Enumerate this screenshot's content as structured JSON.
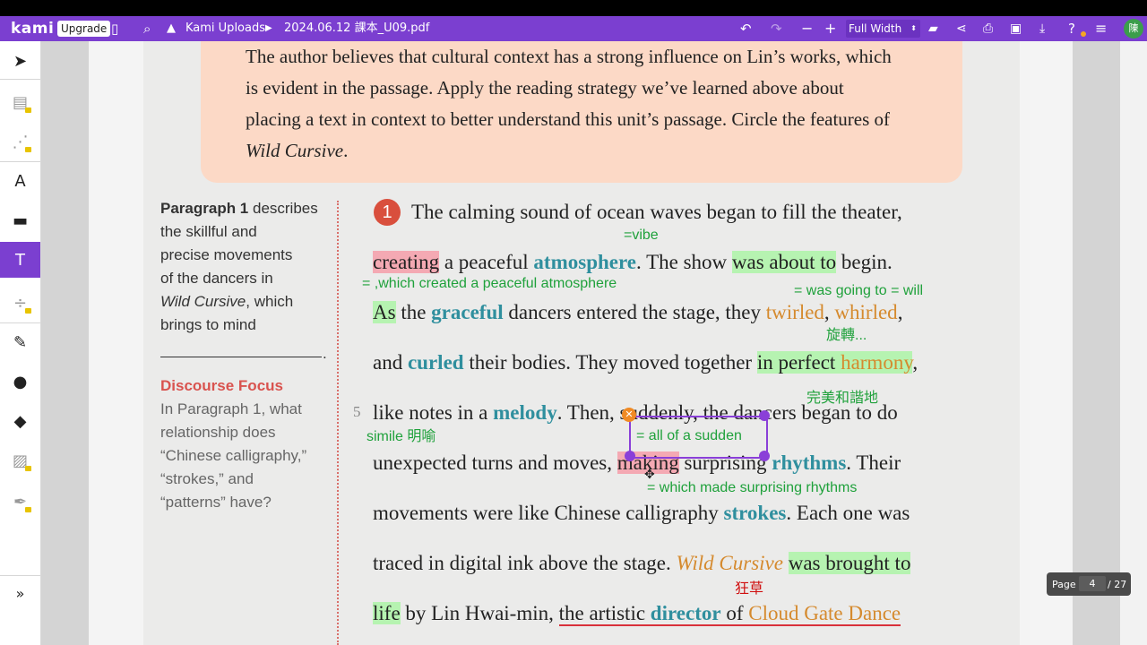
{
  "topbar": {
    "logo": "kami",
    "upgrade": "Upgrade",
    "folder": "Kami Uploads",
    "filename": "2024.06.12 課本_U09.pdf",
    "zoom": "Full Width",
    "avatar": "陳"
  },
  "intro": {
    "line1": "The author believes that cultural context has a strong influence on Lin’s works, which",
    "line2": "is evident in the passage. Apply the reading strategy we’ve learned above about",
    "line3": "placing a text in context to better understand this unit’s passage. Circle the features of",
    "line4_italic": "Wild Cursive",
    "line4_end": "."
  },
  "sidebar": {
    "p1_bold": "Paragraph 1",
    "p1_a": " describes",
    "p1_b": "the skillful and",
    "p1_c": "precise movements",
    "p1_d": "of the dancers in",
    "p1_e_italic": "Wild Cursive",
    "p1_e_rest": ", which",
    "p1_f": "brings to mind",
    "p1_g": ".",
    "df_title": "Discourse Focus",
    "df_a": "In Paragraph 1, what",
    "df_b": "relationship does",
    "df_c": "“Chinese calligraphy,”",
    "df_d": "“strokes,” and",
    "df_e": "“patterns” have?"
  },
  "passage": {
    "para_num": "1",
    "line_num_5": "5",
    "l1": "The calming sound of ocean waves began to fill the theater,",
    "l2_a": "creating",
    "l2_b": " a peaceful ",
    "l2_c": "atmosphere",
    "l2_d": ". The show ",
    "l2_e": "was about to",
    "l2_f": " begin.",
    "l3_a": "As",
    "l3_b": " the ",
    "l3_c": "graceful",
    "l3_d": " dancers entered the stage, they ",
    "l3_e": "twirled",
    "l3_f": ", ",
    "l3_g": "whirled",
    "l3_h": ",",
    "l4_a": "and ",
    "l4_b": "curled",
    "l4_c": " their bodies. They moved together ",
    "l4_d": "in perfect ",
    "l4_e": "harmony",
    "l4_f": ",",
    "l5_a": "like notes in a ",
    "l5_b": "melody",
    "l5_c": ". Then, suddenly, the dancers began to do",
    "l6_a": "unexpected turns and moves, ",
    "l6_b": "making",
    "l6_c": " surprising ",
    "l6_d": "rhythms",
    "l6_e": ". Their",
    "l7_a": "movements were like Chinese calligraphy ",
    "l7_b": "strokes",
    "l7_c": ". Each one was",
    "l8_a": "traced in digital ink above the stage. ",
    "l8_b": "Wild Cursive",
    "l8_c": " ",
    "l8_d": "was brought to",
    "l9_a": "life",
    "l9_b": " by Lin Hwai-min, ",
    "l9_c": "the artistic ",
    "l9_d": "director",
    "l9_e": " of ",
    "l9_f": "Cloud Gate Dance"
  },
  "notes": {
    "vibe": "=vibe",
    "which_created": "= ,which created a peaceful atmosphere",
    "was_going": "= was going to = will",
    "xuanzhuan": "旋轉...",
    "harmony_zh": "完美和諧地",
    "simile": "simile  明喻",
    "sudden": "= all of a sudden",
    "which_made": "= which made surprising rhythms",
    "kuangcao": "狂草"
  },
  "pagenav": {
    "label": "Page",
    "current": "4",
    "total": "/ 27"
  },
  "colors": {
    "accent": "#7b3fd0",
    "highlight_pink": "#f4a9b3",
    "highlight_green": "#b6f3b1",
    "teal": "#2f8f9e",
    "orange": "#d58a2e"
  }
}
